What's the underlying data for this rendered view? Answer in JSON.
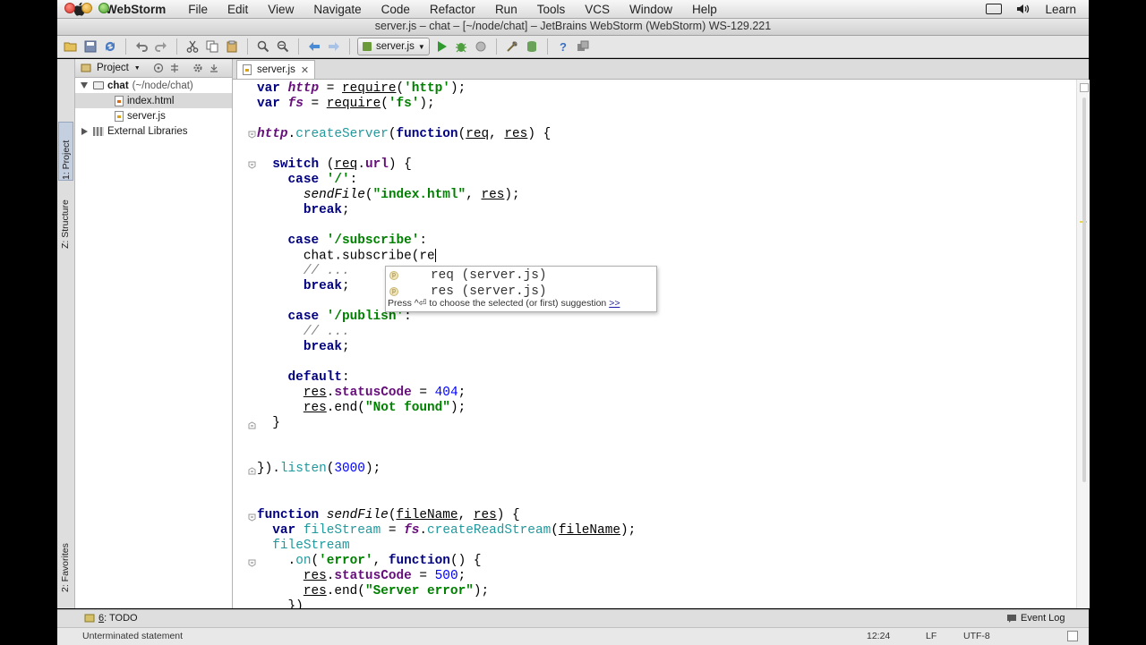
{
  "menubar": {
    "app": "WebStorm",
    "items": [
      "File",
      "Edit",
      "View",
      "Navigate",
      "Code",
      "Refactor",
      "Run",
      "Tools",
      "VCS",
      "Window",
      "Help"
    ],
    "user": "Learn"
  },
  "window": {
    "title": "server.js – chat – [~/node/chat] – JetBrains WebStorm (WebStorm) WS-129.221"
  },
  "toolbar": {
    "run_config": "server.js"
  },
  "tool_tabs": {
    "project": "1: Project",
    "structure": "Z: Structure",
    "favorites": "2: Favorites",
    "todo_num": "6",
    "todo": ": TODO",
    "event_log": "Event Log"
  },
  "project": {
    "header": "Project",
    "root_name": "chat",
    "root_path": "(~/node/chat)",
    "files": [
      "index.html",
      "server.js"
    ],
    "libraries": "External Libraries"
  },
  "editor": {
    "tab": "server.js"
  },
  "completion": {
    "items": [
      {
        "name": "req",
        "source": "(server.js)"
      },
      {
        "name": "res",
        "source": "(server.js)"
      }
    ],
    "hint_prefix": "Press ^⏎ to choose the selected (or first) suggestion",
    "hint_link": ">>"
  },
  "status": {
    "message": "Unterminated statement",
    "position": "12:24",
    "line_sep": "LF",
    "encoding": "UTF-8"
  }
}
